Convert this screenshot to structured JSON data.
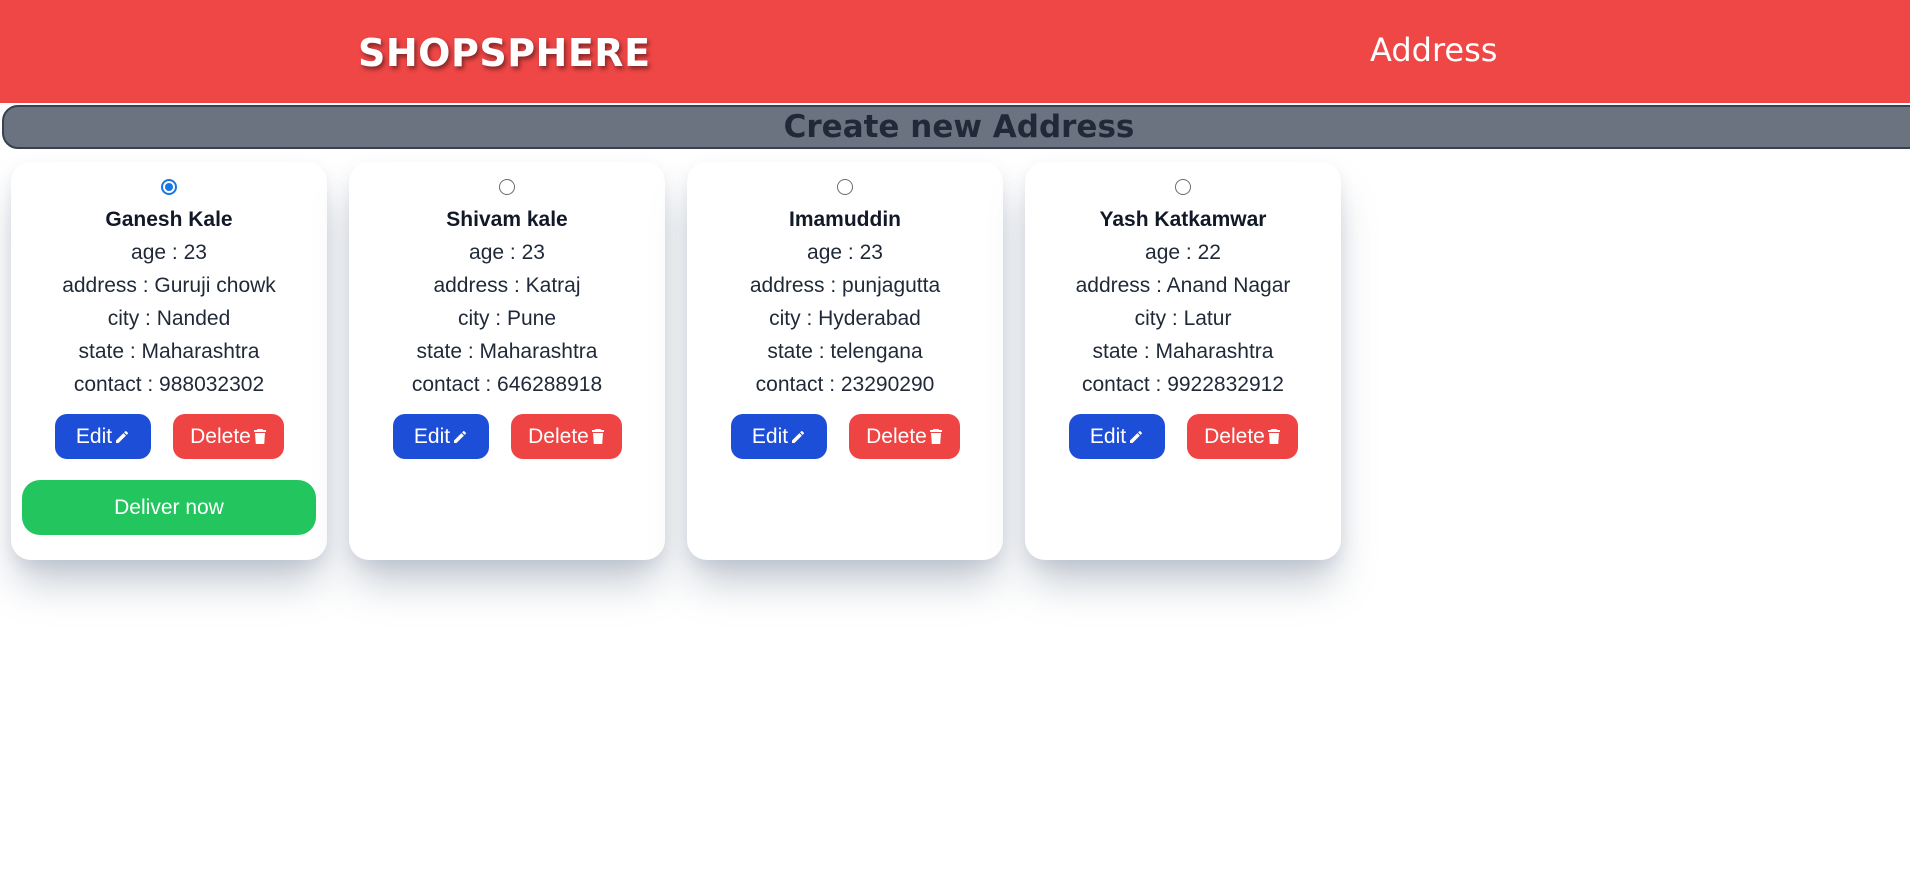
{
  "header": {
    "brand": "SHOPSPHERE",
    "page_title": "Address",
    "background_color": "#ef4646"
  },
  "create_button": {
    "label": "Create new Address"
  },
  "addresses": [
    {
      "name": "Ganesh Kale",
      "selected": true,
      "age": "age : 23",
      "address": "address : Guruji chowk",
      "city": "city : Nanded",
      "state": "state : Maharashtra",
      "contact": "contact : 988032302"
    },
    {
      "name": "Shivam kale",
      "selected": false,
      "age": "age : 23",
      "address": "address : Katraj",
      "city": "city : Pune",
      "state": "state : Maharashtra",
      "contact": "contact : 646288918"
    },
    {
      "name": "Imamuddin",
      "selected": false,
      "age": "age : 23",
      "address": "address : punjagutta",
      "city": "city : Hyderabad",
      "state": "state : telengana",
      "contact": "contact : 23290290"
    },
    {
      "name": "Yash Katkamwar",
      "selected": false,
      "age": "age : 22",
      "address": "address : Anand Nagar",
      "city": "city : Latur",
      "state": "state : Maharashtra",
      "contact": "contact : 9922832912"
    }
  ],
  "buttons": {
    "edit_label": "Edit",
    "delete_label": "Delete",
    "deliver_label": "Deliver now",
    "edit_icon": "pencil-icon",
    "delete_icon": "trash-icon"
  },
  "colors": {
    "edit": "#1d4ed8",
    "delete": "#ef4444",
    "deliver": "#22c55e",
    "create_bar": "#6b7280",
    "radio_selected": "#1976e8"
  }
}
